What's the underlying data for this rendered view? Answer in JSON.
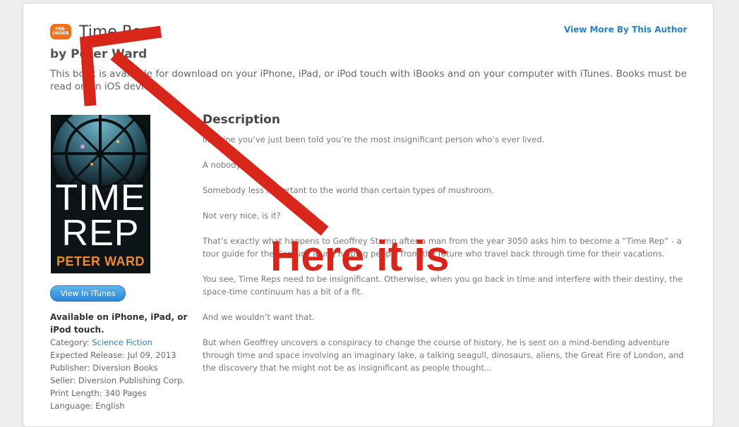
{
  "badge": {
    "line1": "PRE-",
    "line2": "ORDER"
  },
  "book": {
    "title": "Time Rep",
    "author": "by Peter Ward",
    "availability": "This book is available for download on your iPhone, iPad, or iPod touch with iBooks and on your computer with iTunes. Books must be read on an iOS device.",
    "cover_title_line1": "TIME",
    "cover_title_line2": "REP",
    "cover_author": "PETER WARD"
  },
  "header": {
    "view_more": "View More By This Author"
  },
  "itunes_button": "View In iTunes",
  "details": {
    "available": "Available on iPhone, iPad, or iPod touch.",
    "category_label": "Category: ",
    "category": "Science Fiction",
    "release": "Expected Release: Jul 09, 2013",
    "publisher": "Publisher: Diversion Books",
    "seller": "Seller: Diversion Publishing Corp.",
    "print_length": "Print Length: 340 Pages",
    "language": "Language: English"
  },
  "description": {
    "heading": "Description",
    "paragraphs": [
      "Imagine you’ve just been told you’re the most insignificant person who’s ever lived.",
      " A nobody.",
      "Somebody less important to the world than certain types of mushroom.",
      "Not very nice, is it?",
      "That’s exactly what happens to Geoffrey Stamp after a man from the year 3050 asks him to become a “Time Rep” - a tour guide for the Century Tours, helping people from the future who travel back through time for their vacations.",
      "You see, Time Reps need to be insignificant. Otherwise, when you go back in time and interfere with their destiny, the space-time continuum has a bit of a fit.",
      "And we wouldn’t want that.",
      "But when Geoffrey uncovers a conspiracy to change the course of history, he is sent on a mind-bending adventure through time and space involving an imaginary lake, a talking seagull, dinosaurs, aliens, the Great Fire of London, and the discovery that he might not be as insignificant as people thought..."
    ]
  },
  "annotation": {
    "text": "Here it is",
    "color": "#d8261b"
  },
  "colors": {
    "accent": "#2b7fc3",
    "badge": "#f0701a"
  }
}
